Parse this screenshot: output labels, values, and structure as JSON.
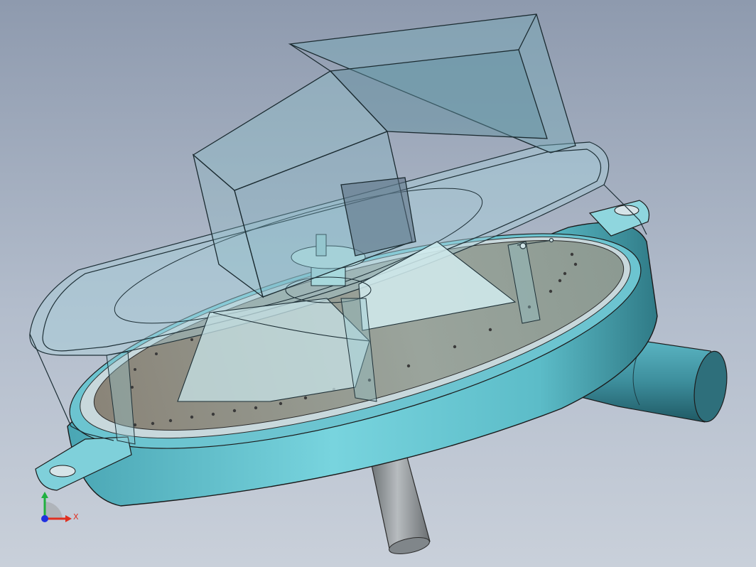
{
  "viewport": {
    "background_top": "#8e9aae",
    "background_bottom": "#c9d0da"
  },
  "model": {
    "housing_color": "#6fc8d4",
    "glass_color": "#a8d2dc",
    "plate_color": "#9c9a90",
    "shaft_color": "#9aa0a3"
  },
  "triad": {
    "x_label": "X",
    "x_color": "#e03020",
    "y_color": "#20b040",
    "z_color": "#2030e0"
  }
}
